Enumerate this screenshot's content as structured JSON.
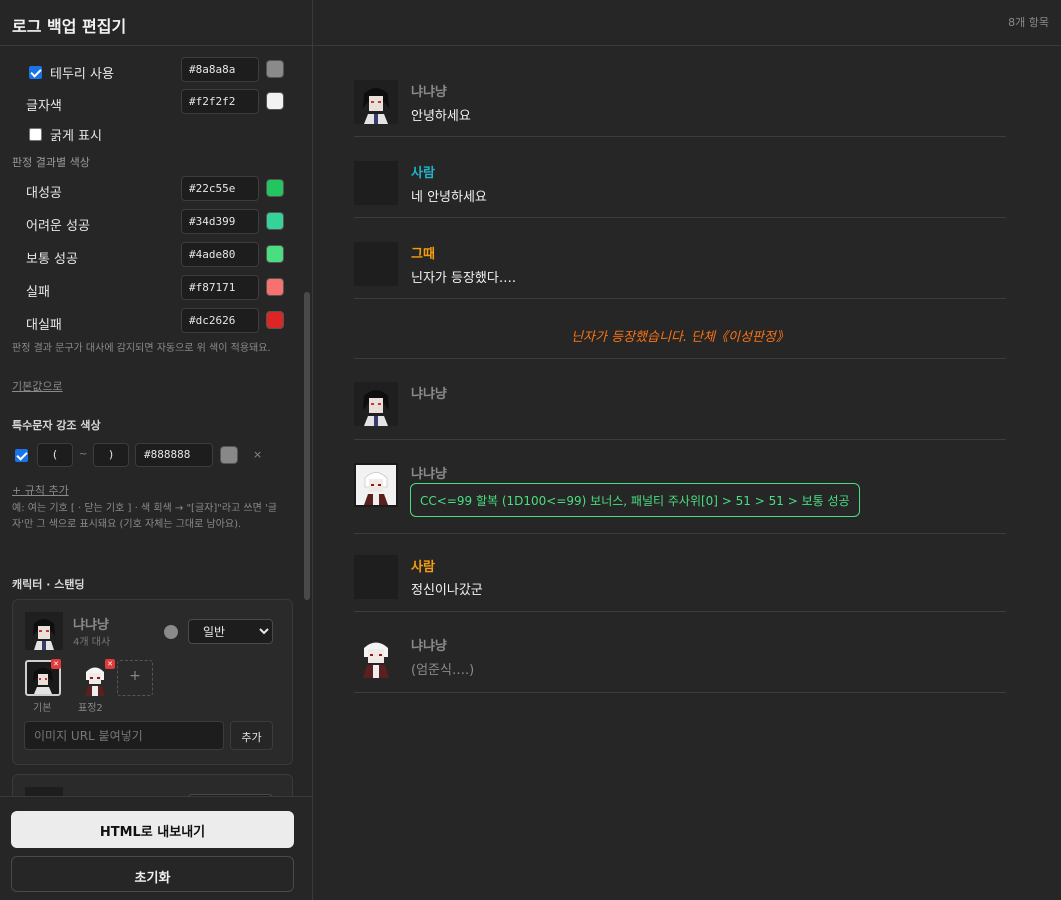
{
  "sidebar": {
    "title": "로그 백업 편집기",
    "border": {
      "label": "테두리 사용",
      "checked": true,
      "hex": "#8a8a8a"
    },
    "text_color": {
      "label": "글자색",
      "hex": "#f2f2f2"
    },
    "bold": {
      "label": "굵게 표시",
      "checked": false
    },
    "judge_section": "판정 결과별 색상",
    "judge_colors": [
      {
        "label": "대성공",
        "hex": "#22c55e"
      },
      {
        "label": "어려운 성공",
        "hex": "#34d399"
      },
      {
        "label": "보통 성공",
        "hex": "#4ade80"
      },
      {
        "label": "실패",
        "hex": "#f87171"
      },
      {
        "label": "대실패",
        "hex": "#dc2626"
      }
    ],
    "judge_note": "판정 결과 문구가 대사에 감지되면 자동으로 위 색이 적용돼요.",
    "reset_default": "기본값으로",
    "special_section": "특수문자 강조 색상",
    "special_rule": {
      "open": "(",
      "tilde": "~",
      "close": ")",
      "hex": "#888888",
      "remove": "×"
    },
    "add_rule": "+ 규칙 추가",
    "special_note": "예: 여는 기호 [ · 닫는 기호 ] · 색 회색 → \"[글자]\"라고 쓰면 '글자'만 그 색으로 표시돼요 (기호 자체는 그대로 남아요).",
    "char_section": "캐릭터 · 스탠딩",
    "character": {
      "name": "냐냐냥",
      "lines": "4개 대사",
      "mode": "일반",
      "modes": [
        "일반"
      ],
      "thumbs": [
        {
          "label": "기본"
        },
        {
          "label": "표정2"
        }
      ],
      "add_thumb": "+",
      "url_placeholder": "이미지 URL 붙여넣기",
      "add_button": "추가"
    },
    "export_button": "HTML로 내보내기",
    "reset_button": "초기화"
  },
  "main": {
    "count": "8개 항목",
    "messages": [
      {
        "name": "냐냐냥",
        "text": "안녕하세요",
        "name_color": "#8a8a8a"
      },
      {
        "name": "사람",
        "text": "네 안녕하세요",
        "name_color": "#22b3c8"
      },
      {
        "name": "그때",
        "text": "닌자가 등장했다….",
        "name_color": "#f59e0b"
      },
      {
        "narration": "닌자가 등장했습니다. 단체《이성판정》"
      },
      {
        "name": "냐냐냥",
        "text": "",
        "name_color": "#8a8a8a"
      },
      {
        "name": "냐냐냥",
        "dice": "CC<=99 할복 (1D100<=99) 보너스, 패널티 주사위[0]  >  51  >  51  >  보통 성공",
        "name_color": "#8a8a8a"
      },
      {
        "name": "사람",
        "text": "정신이나갔군",
        "name_color": "#f59e0b"
      },
      {
        "name": "냐냐냥",
        "text": "(엄준식….)",
        "name_color": "#8a8a8a"
      }
    ]
  }
}
